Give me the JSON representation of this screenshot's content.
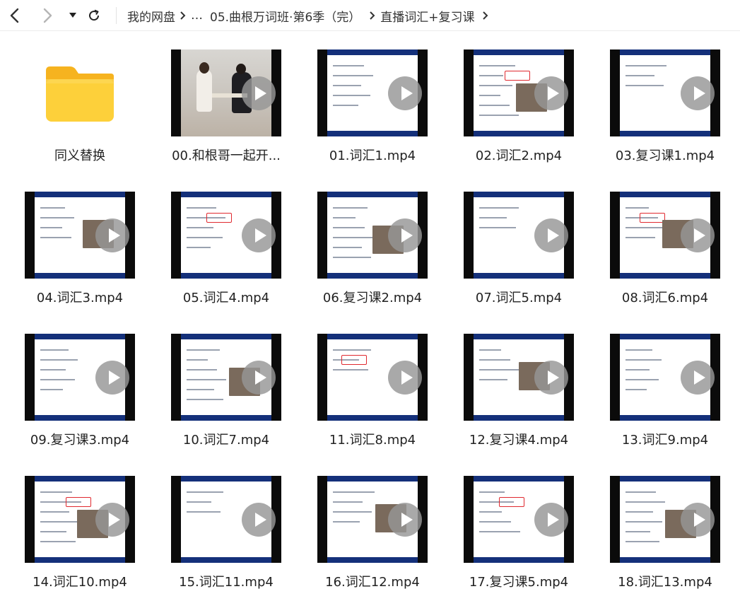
{
  "toolbar": {
    "back_icon": "chevron-left-icon",
    "forward_icon": "chevron-right-icon",
    "dropdown_icon": "caret-down-icon",
    "refresh_icon": "refresh-icon"
  },
  "breadcrumb": {
    "items": [
      "我的网盘",
      "…",
      "05.曲根万词班·第6季（完）",
      "直播词汇+复习课"
    ]
  },
  "accent": "#14307a",
  "files": [
    {
      "name": "同义替换",
      "type": "folder"
    },
    {
      "name": "00.和根哥一起开...",
      "type": "video"
    },
    {
      "name": "01.词汇1.mp4",
      "type": "video"
    },
    {
      "name": "02.词汇2.mp4",
      "type": "video"
    },
    {
      "name": "03.复习课1.mp4",
      "type": "video"
    },
    {
      "name": "04.词汇3.mp4",
      "type": "video"
    },
    {
      "name": "05.词汇4.mp4",
      "type": "video"
    },
    {
      "name": "06.复习课2.mp4",
      "type": "video"
    },
    {
      "name": "07.词汇5.mp4",
      "type": "video"
    },
    {
      "name": "08.词汇6.mp4",
      "type": "video"
    },
    {
      "name": "09.复习课3.mp4",
      "type": "video"
    },
    {
      "name": "10.词汇7.mp4",
      "type": "video"
    },
    {
      "name": "11.词汇8.mp4",
      "type": "video"
    },
    {
      "name": "12.复习课4.mp4",
      "type": "video"
    },
    {
      "name": "13.词汇9.mp4",
      "type": "video"
    },
    {
      "name": "14.词汇10.mp4",
      "type": "video"
    },
    {
      "name": "15.词汇11.mp4",
      "type": "video"
    },
    {
      "name": "16.词汇12.mp4",
      "type": "video"
    },
    {
      "name": "17.复习课5.mp4",
      "type": "video"
    },
    {
      "name": "18.词汇13.mp4",
      "type": "video"
    }
  ]
}
